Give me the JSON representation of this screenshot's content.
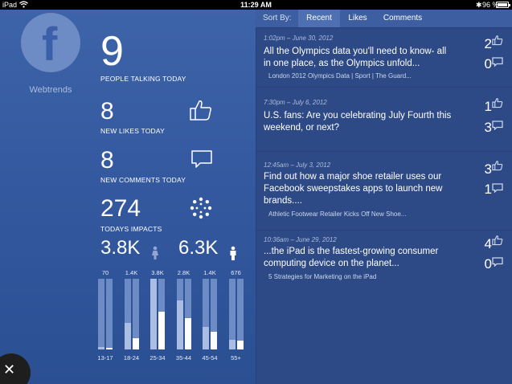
{
  "status": {
    "carrier": "iPad",
    "time": "11:29 AM",
    "battery": "96 %"
  },
  "brand": {
    "logo_letter": "f",
    "name": "Webtrends"
  },
  "stats": {
    "talking": {
      "value": "9",
      "label": "PEOPLE TALKING TODAY"
    },
    "likes": {
      "value": "8",
      "label": "NEW LIKES TODAY"
    },
    "comments": {
      "value": "8",
      "label": "NEW COMMENTS TODAY"
    },
    "impacts": {
      "value": "274",
      "label": "TODAYS IMPACTS"
    }
  },
  "demographics": {
    "female_total": "3.8K",
    "male_total": "6.3K"
  },
  "chart_data": {
    "type": "bar",
    "categories": [
      "13-17",
      "18-24",
      "25-34",
      "35-44",
      "45-54",
      "55+"
    ],
    "value_labels": [
      "70",
      "1.4K",
      "3.8K",
      "2.8K",
      "1.4K",
      "676"
    ],
    "series": [
      {
        "name": "female",
        "values": [
          0.03,
          0.38,
          1.0,
          0.69,
          0.32,
          0.14
        ]
      },
      {
        "name": "male",
        "values": [
          0.02,
          0.16,
          0.53,
          0.44,
          0.25,
          0.13
        ]
      }
    ]
  },
  "sort": {
    "label": "Sort By:",
    "tabs": [
      "Recent",
      "Likes",
      "Comments"
    ],
    "active": "Recent"
  },
  "posts": [
    {
      "meta": "1:02pm – June 30, 2012",
      "text": "All the Olympics data you'll need to know- all in one place, as the Olympics unfold...",
      "link": "London 2012 Olympics Data | Sport | The Guard...",
      "likes": "2",
      "comments": "0"
    },
    {
      "meta": "7:30pm – July 6, 2012",
      "text": "U.S. fans: Are you celebrating July Fourth this weekend, or next?",
      "link": "",
      "likes": "1",
      "comments": "3"
    },
    {
      "meta": "12:45am – July 3, 2012",
      "text": "Find out how a major shoe retailer uses our Facebook sweepstakes apps to launch new brands....",
      "link": "Athletic Footwear Retailer Kicks Off New Shoe...",
      "likes": "3",
      "comments": "1"
    },
    {
      "meta": "10:36am – June 29, 2012",
      "text": "...the iPad is the fastest-growing consumer computing device on the planet...",
      "link": "5 Strategies for Marketing on the iPad",
      "likes": "4",
      "comments": "0"
    }
  ],
  "icons": {
    "like": "thumbs-up-icon",
    "comment": "speech-bubble-icon",
    "impacts": "dotted-circle-icon",
    "female": "female-person-icon",
    "male": "male-person-icon",
    "close": "close-icon"
  },
  "colors": {
    "accent": "#3b5fa8",
    "panel_left": "#3459a0",
    "panel_right": "#2e4a86"
  }
}
